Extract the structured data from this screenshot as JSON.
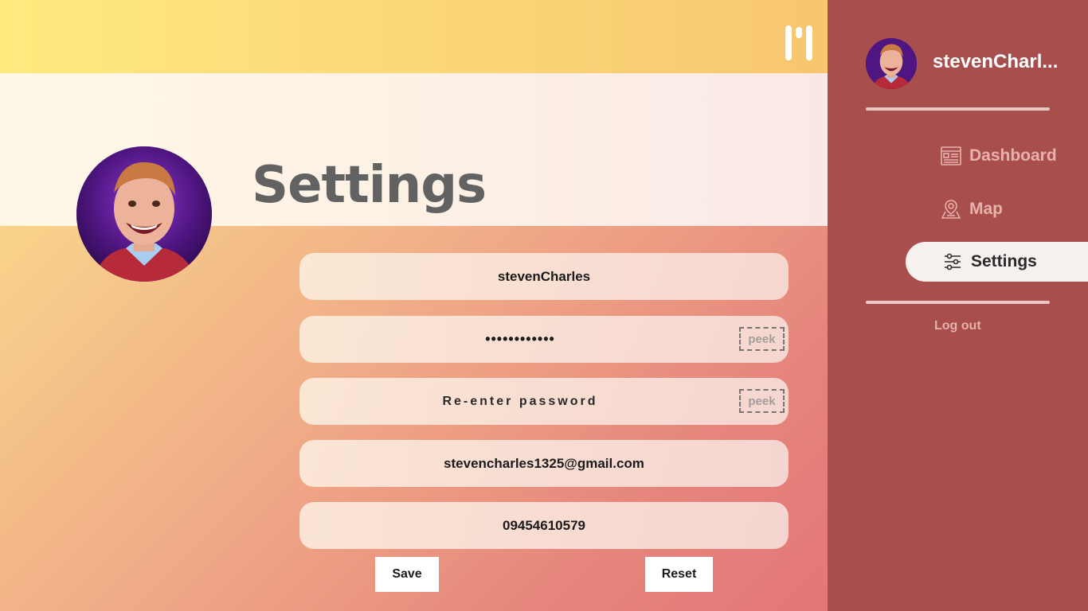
{
  "page": {
    "title": "Settings"
  },
  "form": {
    "username_value": "stevenCharles",
    "password_value": "••••••••••••",
    "reenter_placeholder": "Re-enter password",
    "email_value": "stevencharles1325@gmail.com",
    "phone_value": "09454610579",
    "peek_label": "peek",
    "save_label": "Save",
    "reset_label": "Reset"
  },
  "sidebar": {
    "username": "stevenCharl...",
    "items": [
      {
        "label": "Dashboard",
        "icon": "dashboard-icon"
      },
      {
        "label": "Map",
        "icon": "map-pin-icon"
      },
      {
        "label": "Settings",
        "icon": "sliders-icon",
        "active": true
      }
    ],
    "logout_label": "Log out"
  },
  "colors": {
    "sidebar_bg": "#a84f4d",
    "active_item_bg": "#f7f1f0",
    "title_color": "#626262"
  }
}
